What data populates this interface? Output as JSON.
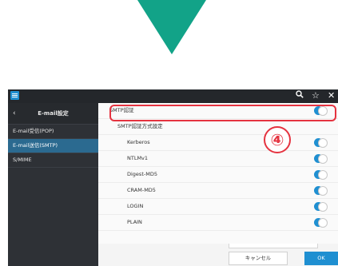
{
  "colors": {
    "arrow": "#12a388",
    "accent": "#1f8fd1",
    "highlight": "#e53340"
  },
  "step_badge": "④",
  "toolbar": {
    "icons": [
      "hamburger-menu-icon",
      "search-icon",
      "star-icon",
      "close-icon"
    ]
  },
  "sidebar": {
    "back_icon": "chevron-left-icon",
    "title": "E-mail設定",
    "items": [
      {
        "label": "E-mail受信(POP)",
        "active": false
      },
      {
        "label": "E-mail送信(SMTP)",
        "active": true
      },
      {
        "label": "S/MIME",
        "active": false
      }
    ]
  },
  "main": {
    "smtp_auth": {
      "label": "SMTP認証",
      "enabled": true
    },
    "auth_method_heading": "SMTP認証方式設定",
    "methods": [
      {
        "label": "Kerberos",
        "enabled": true
      },
      {
        "label": "NTLMv1",
        "enabled": true
      },
      {
        "label": "Digest-MD5",
        "enabled": true
      },
      {
        "label": "CRAM-MD5",
        "enabled": true
      },
      {
        "label": "LOGIN",
        "enabled": true
      },
      {
        "label": "PLAIN",
        "enabled": true
      }
    ]
  },
  "footer": {
    "cancel_label": "キャンセル",
    "ok_label": "OK"
  }
}
